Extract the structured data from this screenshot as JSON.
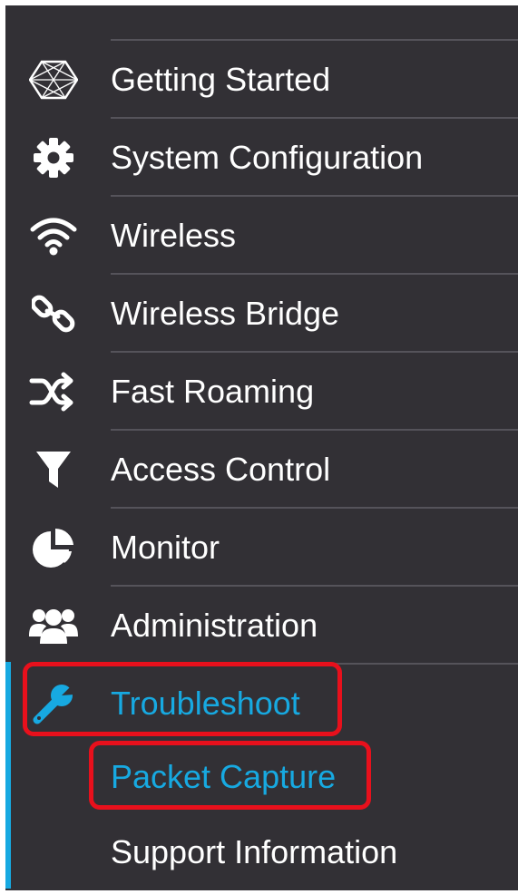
{
  "sidebar": {
    "items": [
      {
        "label": "Getting Started",
        "icon": "hexagon-icon"
      },
      {
        "label": "System Configuration",
        "icon": "gear-icon"
      },
      {
        "label": "Wireless",
        "icon": "wifi-icon"
      },
      {
        "label": "Wireless Bridge",
        "icon": "link-icon"
      },
      {
        "label": "Fast Roaming",
        "icon": "shuffle-icon"
      },
      {
        "label": "Access Control",
        "icon": "filter-icon"
      },
      {
        "label": "Monitor",
        "icon": "pie-chart-icon"
      },
      {
        "label": "Administration",
        "icon": "users-icon"
      },
      {
        "label": "Troubleshoot",
        "icon": "wrench-icon",
        "active": true
      }
    ],
    "subitems": [
      {
        "label": "Packet Capture",
        "active": true
      },
      {
        "label": "Support Information"
      }
    ]
  },
  "colors": {
    "panel_background": "#323035",
    "text": "#ffffff",
    "accent": "#17a9e1",
    "highlight": "#e8101c",
    "divider": "#55535a"
  }
}
